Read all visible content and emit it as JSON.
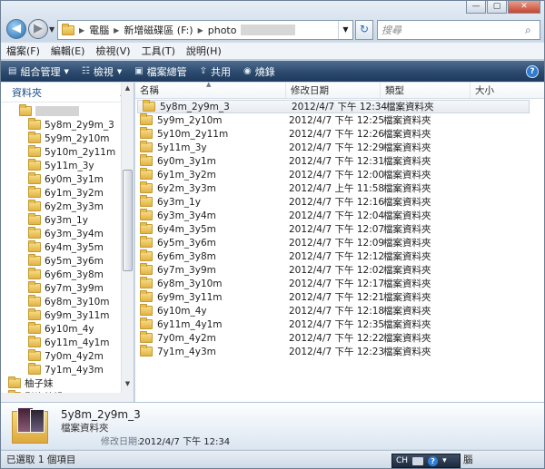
{
  "window": {
    "controls": {
      "minimize": "—",
      "maximize": "▢",
      "close": "✕"
    }
  },
  "nav": {
    "back_icon": "arrow-left-icon",
    "forward_icon": "arrow-right-icon"
  },
  "address": {
    "crumbs": [
      "電腦",
      "新增磁碟區 (F:)",
      "photo"
    ]
  },
  "search": {
    "placeholder": "搜尋"
  },
  "menu": [
    "檔案(F)",
    "編輯(E)",
    "檢視(V)",
    "工具(T)",
    "說明(H)"
  ],
  "commands": [
    {
      "label": "組合管理",
      "icon": "organize-icon",
      "has_dropdown": true
    },
    {
      "label": "檢視",
      "icon": "views-icon",
      "has_dropdown": true
    },
    {
      "label": "檔案總管",
      "icon": "explorer-icon",
      "has_dropdown": false
    },
    {
      "label": "共用",
      "icon": "share-icon",
      "has_dropdown": false
    },
    {
      "label": "燒錄",
      "icon": "burn-icon",
      "has_dropdown": false
    }
  ],
  "left_pane": {
    "header": "資料夾",
    "children": [
      "5y8m_2y9m_3",
      "5y9m_2y10m",
      "5y10m_2y11m",
      "5y11m_3y",
      "6y0m_3y1m",
      "6y1m_3y2m",
      "6y2m_3y3m",
      "6y3m_1y",
      "6y3m_3y4m",
      "6y4m_3y5m",
      "6y5m_3y6m",
      "6y6m_3y8m",
      "6y7m_3y9m",
      "6y8m_3y10m",
      "6y9m_3y11m",
      "6y10m_4y",
      "6y11m_4y1m",
      "7y0m_4y2m",
      "7y1m_4y3m"
    ],
    "siblings": [
      "柚子妹",
      "影片剪輯"
    ]
  },
  "file_list": {
    "columns": {
      "name": "名稱",
      "date": "修改日期",
      "type": "類型",
      "size": "大小"
    },
    "rows": [
      {
        "name": "5y8m_2y9m_3",
        "date": "2012/4/7 下午 12:34",
        "type": "檔案資料夾"
      },
      {
        "name": "5y9m_2y10m",
        "date": "2012/4/7 下午 12:25",
        "type": "檔案資料夾"
      },
      {
        "name": "5y10m_2y11m",
        "date": "2012/4/7 下午 12:26",
        "type": "檔案資料夾"
      },
      {
        "name": "5y11m_3y",
        "date": "2012/4/7 下午 12:29",
        "type": "檔案資料夾"
      },
      {
        "name": "6y0m_3y1m",
        "date": "2012/4/7 下午 12:31",
        "type": "檔案資料夾"
      },
      {
        "name": "6y1m_3y2m",
        "date": "2012/4/7 下午 12:00",
        "type": "檔案資料夾"
      },
      {
        "name": "6y2m_3y3m",
        "date": "2012/4/7 上午 11:58",
        "type": "檔案資料夾"
      },
      {
        "name": "6y3m_1y",
        "date": "2012/4/7 下午 12:16",
        "type": "檔案資料夾"
      },
      {
        "name": "6y3m_3y4m",
        "date": "2012/4/7 下午 12:04",
        "type": "檔案資料夾"
      },
      {
        "name": "6y4m_3y5m",
        "date": "2012/4/7 下午 12:07",
        "type": "檔案資料夾"
      },
      {
        "name": "6y5m_3y6m",
        "date": "2012/4/7 下午 12:09",
        "type": "檔案資料夾"
      },
      {
        "name": "6y6m_3y8m",
        "date": "2012/4/7 下午 12:12",
        "type": "檔案資料夾"
      },
      {
        "name": "6y7m_3y9m",
        "date": "2012/4/7 下午 12:02",
        "type": "檔案資料夾"
      },
      {
        "name": "6y8m_3y10m",
        "date": "2012/4/7 下午 12:17",
        "type": "檔案資料夾"
      },
      {
        "name": "6y9m_3y11m",
        "date": "2012/4/7 下午 12:21",
        "type": "檔案資料夾"
      },
      {
        "name": "6y10m_4y",
        "date": "2012/4/7 下午 12:18",
        "type": "檔案資料夾"
      },
      {
        "name": "6y11m_4y1m",
        "date": "2012/4/7 下午 12:35",
        "type": "檔案資料夾"
      },
      {
        "name": "7y0m_4y2m",
        "date": "2012/4/7 下午 12:22",
        "type": "檔案資料夾"
      },
      {
        "name": "7y1m_4y3m",
        "date": "2012/4/7 下午 12:23",
        "type": "檔案資料夾"
      }
    ],
    "selected_index": 0
  },
  "details": {
    "name": "5y8m_2y9m_3",
    "type": "檔案資料夾",
    "date_label": "修改日期:",
    "date_value": "2012/4/7 下午 12:34"
  },
  "status": {
    "left": "已選取 1 個項目",
    "right": "腦"
  },
  "langbar": {
    "lang": "CH"
  },
  "colors": {
    "command_bar": "#2b4a6e",
    "selection": "#e6ebf1",
    "tree_header": "#1a4f8b"
  }
}
